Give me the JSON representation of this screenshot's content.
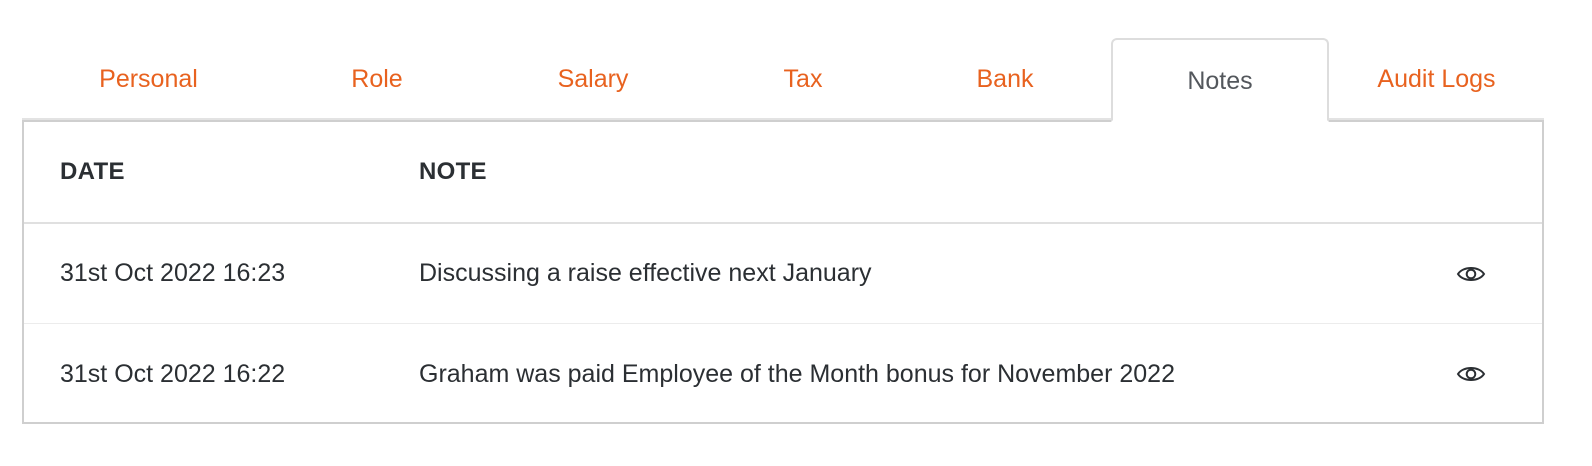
{
  "tabs": [
    {
      "label": "Personal",
      "active": false
    },
    {
      "label": "Role",
      "active": false
    },
    {
      "label": "Salary",
      "active": false
    },
    {
      "label": "Tax",
      "active": false
    },
    {
      "label": "Bank",
      "active": false
    },
    {
      "label": "Notes",
      "active": true
    },
    {
      "label": "Audit Logs",
      "active": false
    }
  ],
  "colors": {
    "tab_link": "#e8621f",
    "tab_active": "#53575c",
    "text": "#2b2f33",
    "border": "#cfcfcf"
  },
  "table": {
    "columns": [
      "DATE",
      "NOTE"
    ],
    "rows": [
      {
        "date": "31st Oct 2022 16:23",
        "note": "Discussing a raise effective next January",
        "action_icon": "eye-icon"
      },
      {
        "date": "31st Oct 2022 16:22",
        "note": "Graham was paid Employee of the Month bonus for November 2022",
        "action_icon": "eye-icon"
      }
    ]
  }
}
